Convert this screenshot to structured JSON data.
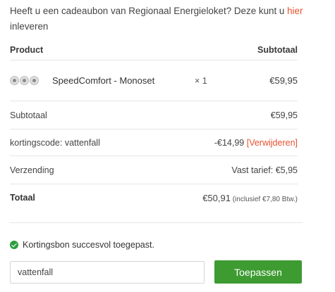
{
  "notice": {
    "text": "Heeft u een cadeaubon van Regionaal Energieloket? Deze kunt u ",
    "link": "hier",
    "suffix": " inleveren"
  },
  "table": {
    "header_product": "Product",
    "header_subtotal": "Subtotaal",
    "item": {
      "name": "SpeedComfort - Monoset",
      "quantity": "× 1",
      "price": "€59,95",
      "thumb_icon": "product-thumbnail-icon"
    },
    "subtotal_label": "Subtotaal",
    "subtotal_value": "€59,95",
    "coupon_label": "kortingscode: vattenfall",
    "coupon_value": "-€14,99",
    "coupon_remove": "[Verwijderen]",
    "shipping_label": "Verzending",
    "shipping_value": "Vast tarief: €5,95",
    "total_label": "Totaal",
    "total_value": "€50,91",
    "total_tax": " (inclusief €7,80 Btw.)"
  },
  "coupon_form": {
    "success_message": "Kortingsbon succesvol toegepast.",
    "input_value": "vattenfall",
    "apply_label": "Toepassen"
  },
  "colors": {
    "link": "#e8502c",
    "button": "#3e9b32",
    "success": "#2e9e3e"
  }
}
